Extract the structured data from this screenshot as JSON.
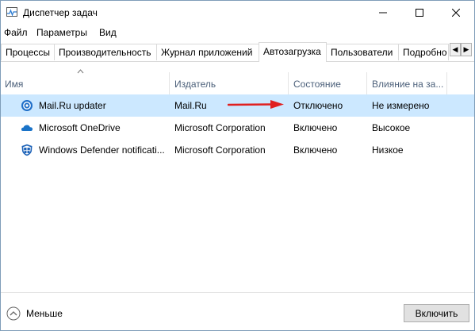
{
  "window": {
    "title": "Диспетчер задач"
  },
  "menu": [
    "Файл",
    "Параметры",
    "Вид"
  ],
  "tabs": [
    "Процессы",
    "Производительность",
    "Журнал приложений",
    "Автозагрузка",
    "Пользователи",
    "Подробно"
  ],
  "active_tab": "Автозагрузка",
  "columns": [
    "Имя",
    "Издатель",
    "Состояние",
    "Влияние на за..."
  ],
  "rows": [
    {
      "name": "Mail.Ru updater",
      "publisher": "Mail.Ru",
      "status": "Отключено",
      "impact": "Не измерено",
      "icon": "mailru-at-icon",
      "selected": true
    },
    {
      "name": "Microsoft OneDrive",
      "publisher": "Microsoft Corporation",
      "status": "Включено",
      "impact": "Высокое",
      "icon": "onedrive-cloud-icon"
    },
    {
      "name": "Windows Defender notificati...",
      "publisher": "Microsoft Corporation",
      "status": "Включено",
      "impact": "Низкое",
      "icon": "windows-defender-shield-icon"
    }
  ],
  "footer": {
    "less_label": "Меньше",
    "enable_button": "Включить"
  },
  "colors": {
    "selection": "#cce8ff",
    "annotation_arrow": "#e02020",
    "header_text": "#4c607a"
  }
}
